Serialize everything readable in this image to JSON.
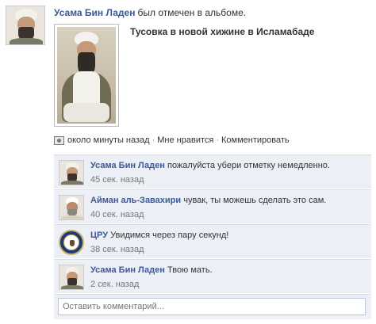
{
  "post": {
    "author": "Усама Бин Ладен",
    "action_text": "был отмечен в альбоме.",
    "album_title": "Тусовка в новой хижине в Исламабаде",
    "meta": {
      "time": "около минуты назад",
      "like": "Мне нравится",
      "comment": "Комментировать",
      "separator": "·"
    }
  },
  "comments": [
    {
      "author": "Усама Бин Ладен",
      "text": "пожалуйста убери отметку немедленно.",
      "time": "45 сек. назад",
      "avatar": "bin-laden-avatar"
    },
    {
      "author": "Айман аль-Завахири",
      "text": "чувак, ты можешь сделать это сам.",
      "time": "40 сек. назад",
      "avatar": "zawahiri-avatar"
    },
    {
      "author": "ЦРУ",
      "text": "Увидимся через пару секунд!",
      "time": "38 сек. назад",
      "avatar": "cia-seal"
    },
    {
      "author": "Усама Бин Ладен",
      "text": "Твою мать.",
      "time": "2 сек. назад",
      "avatar": "bin-laden-avatar"
    }
  ],
  "comment_box": {
    "placeholder": "Оставить комментарий..."
  },
  "colors": {
    "link": "#3b5998",
    "comment_bg": "#eceff5",
    "comment_border": "#d8dfea"
  }
}
